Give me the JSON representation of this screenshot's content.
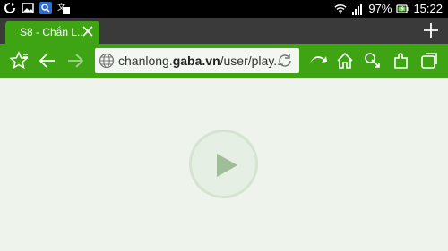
{
  "status_bar": {
    "battery": "97%",
    "time": "15:22"
  },
  "tab": {
    "title": "S8 - Chắn L..."
  },
  "url": {
    "domain_prefix": "chanlong.",
    "domain_bold": "gaba.vn",
    "path": "/user/play..."
  },
  "colors": {
    "accent": "#3ea413",
    "tab_strip": "#3a3a3a",
    "content_bg": "#eef3ec"
  }
}
